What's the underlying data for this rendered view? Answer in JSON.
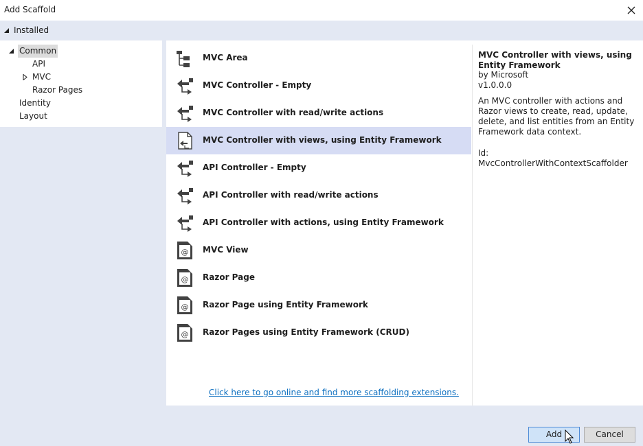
{
  "window": {
    "title": "Add Scaffold"
  },
  "installed": {
    "label": "Installed"
  },
  "tree": {
    "common": "Common",
    "api": "API",
    "mvc": "MVC",
    "razor_pages": "Razor Pages",
    "identity": "Identity",
    "layout": "Layout"
  },
  "templates": [
    {
      "name": "MVC Area",
      "icon": "folder-tree-icon"
    },
    {
      "name": "MVC Controller - Empty",
      "icon": "controller-icon"
    },
    {
      "name": "MVC Controller with read/write actions",
      "icon": "controller-icon"
    },
    {
      "name": "MVC Controller with views, using Entity Framework",
      "icon": "controller-document-icon"
    },
    {
      "name": "API Controller - Empty",
      "icon": "controller-icon"
    },
    {
      "name": "API Controller with read/write actions",
      "icon": "controller-icon"
    },
    {
      "name": "API Controller with actions, using Entity Framework",
      "icon": "controller-icon"
    },
    {
      "name": "MVC View",
      "icon": "razor-view-icon"
    },
    {
      "name": "Razor Page",
      "icon": "razor-view-icon"
    },
    {
      "name": "Razor Page using Entity Framework",
      "icon": "razor-view-icon"
    },
    {
      "name": "Razor Pages using Entity Framework (CRUD)",
      "icon": "razor-view-icon"
    }
  ],
  "online_link": "Click here to go online and find more scaffolding extensions.",
  "details": {
    "title": "MVC Controller with views, using Entity Framework",
    "author": "by Microsoft",
    "version": "v1.0.0.0",
    "description": "An MVC controller with actions and Razor views to create, read, update, delete, and list entities from an Entity Framework data context.",
    "id": "Id: MvcControllerWithContextScaffolder"
  },
  "buttons": {
    "add": "Add",
    "cancel": "Cancel"
  },
  "colors": {
    "selection": "#d6dcf4",
    "pane_bg": "#e3e8f3",
    "link": "#0e70c0"
  }
}
